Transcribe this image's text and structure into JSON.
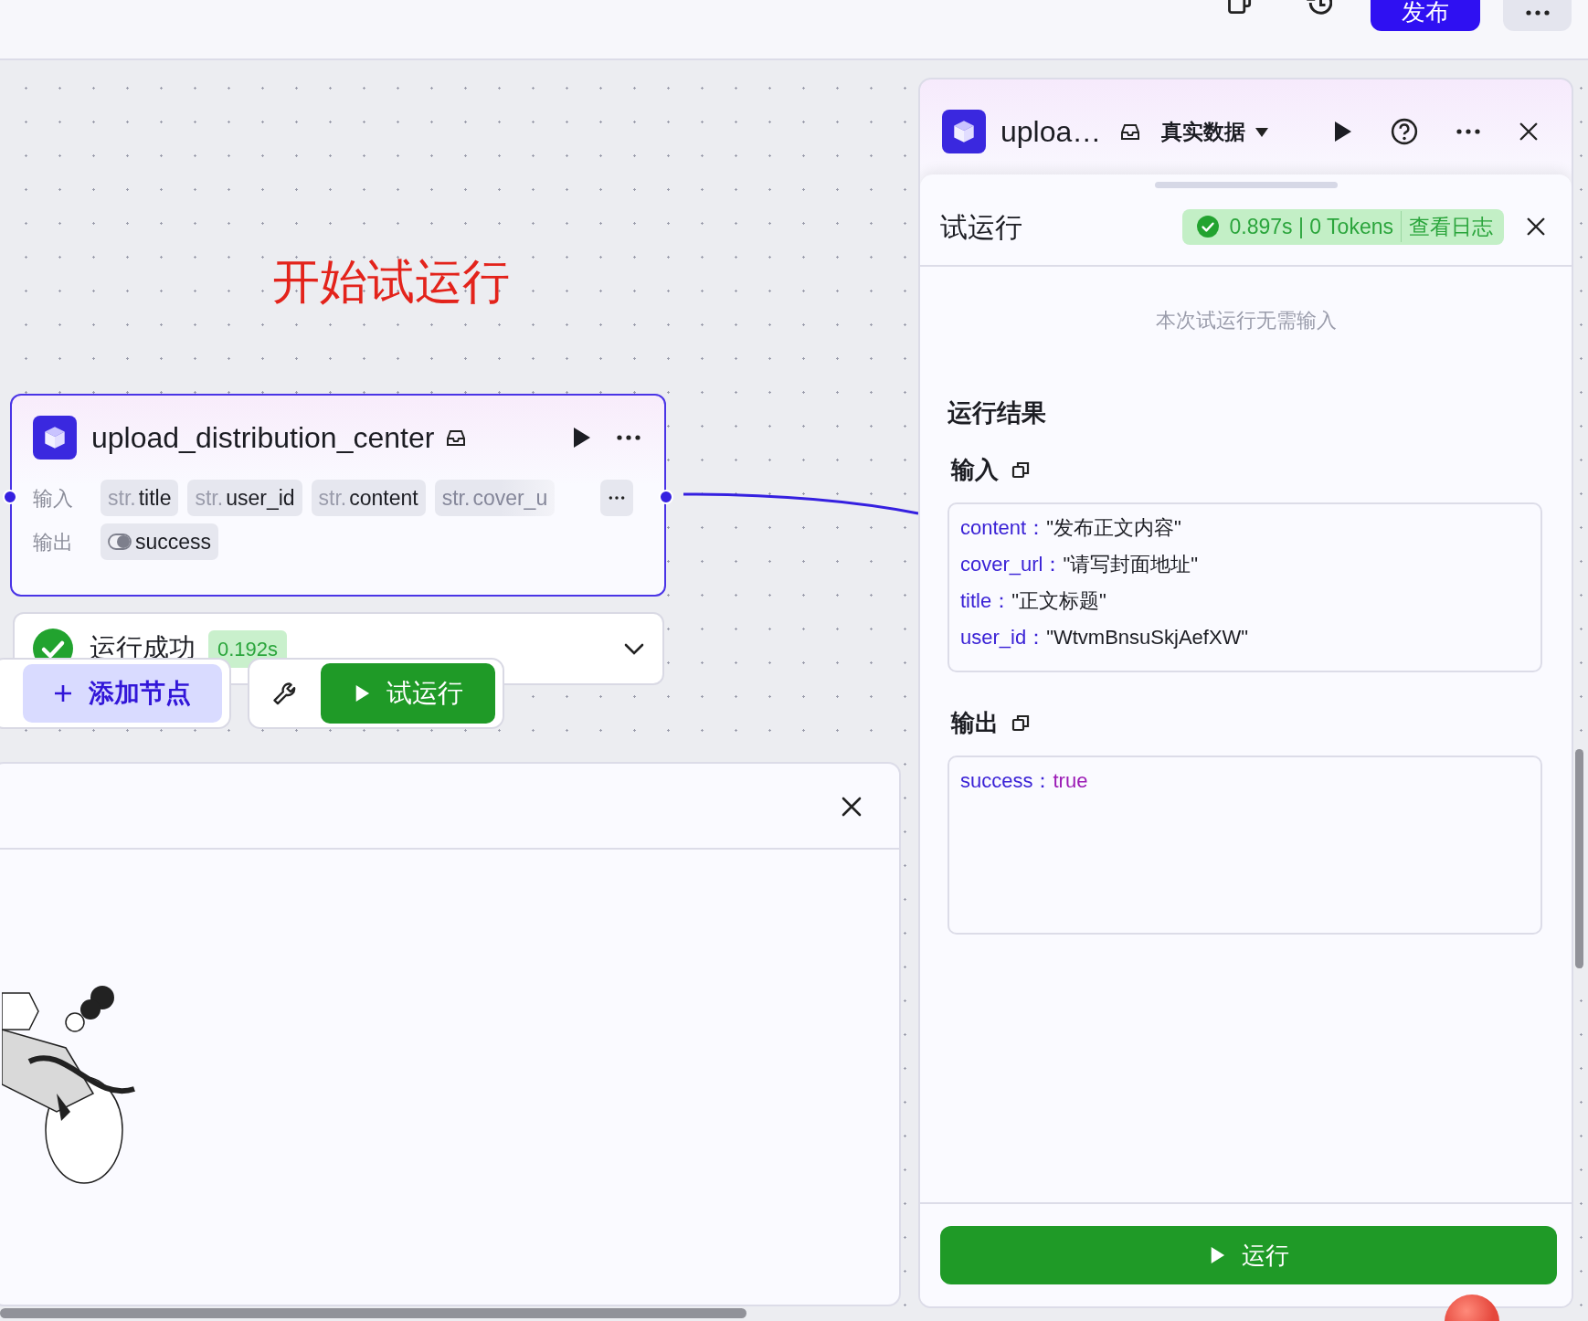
{
  "top_bar": {
    "publish_button": "发布"
  },
  "canvas": {
    "annotation": "开始试运行",
    "node": {
      "title": "upload_distribution_center",
      "input_label": "输入",
      "inputs": [
        {
          "type": "str.",
          "name": "title",
          "faded": false
        },
        {
          "type": "str.",
          "name": "user_id",
          "faded": false
        },
        {
          "type": "str.",
          "name": "content",
          "faded": false
        },
        {
          "type": "str.",
          "name": "cover_u",
          "faded": true
        }
      ],
      "output_label": "输出",
      "outputs": [
        {
          "name": "success",
          "kind": "boolean"
        }
      ],
      "run_status": {
        "label": "运行成功",
        "duration": "0.192s"
      }
    },
    "toolbar": {
      "add_node_button": "添加节点",
      "test_run_button": "试运行"
    }
  },
  "side_panel": {
    "title": "uploa…",
    "data_source": "真实数据",
    "test_run": {
      "title": "试运行",
      "metrics": "0.897s | 0 Tokens",
      "log_link": "查看日志",
      "hint": "本次试运行无需输入",
      "results_title": "运行结果",
      "input_title": "输入",
      "input_fields": [
        {
          "key": "content：",
          "value": "\"发布正文内容\"",
          "kind": "string"
        },
        {
          "key": "cover_url：",
          "value": "\"请写封面地址\"",
          "kind": "string"
        },
        {
          "key": "title：",
          "value": "\"正文标题\"",
          "kind": "string"
        },
        {
          "key": "user_id：",
          "value": "\"WtvmBnsuSkjAefXW\"",
          "kind": "string"
        }
      ],
      "output_title": "输出",
      "output_fields": [
        {
          "key": "success：",
          "value": "true",
          "kind": "boolean"
        }
      ],
      "run_button": "运行"
    }
  }
}
